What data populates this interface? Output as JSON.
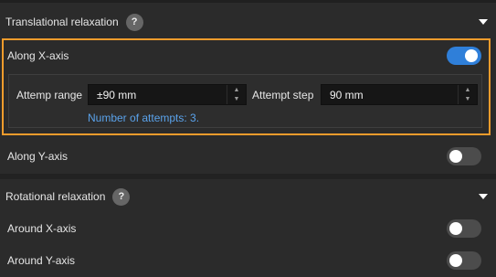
{
  "translational": {
    "title": "Translational relaxation",
    "help_glyph": "?",
    "collapse_icon": "caret-down-icon",
    "along_x": {
      "label": "Along X-axis",
      "enabled": true,
      "attempt_range_label": "Attemp range",
      "attempt_range_value": "±90 mm",
      "attempt_step_label": "Attempt step",
      "attempt_step_value": "90 mm",
      "attempts_note": "Number of attempts: 3."
    },
    "along_y": {
      "label": "Along Y-axis",
      "enabled": false
    }
  },
  "rotational": {
    "title": "Rotational relaxation",
    "help_glyph": "?",
    "collapse_icon": "caret-down-icon",
    "around_x": {
      "label": "Around X-axis",
      "enabled": false
    },
    "around_y": {
      "label": "Around Y-axis",
      "enabled": false
    }
  },
  "colors": {
    "highlight_border": "#f29c2c",
    "toggle_on": "#2f7fd9",
    "toggle_off": "#4c4c4c",
    "info_text": "#5aa2ea",
    "background": "#2b2b2b"
  }
}
